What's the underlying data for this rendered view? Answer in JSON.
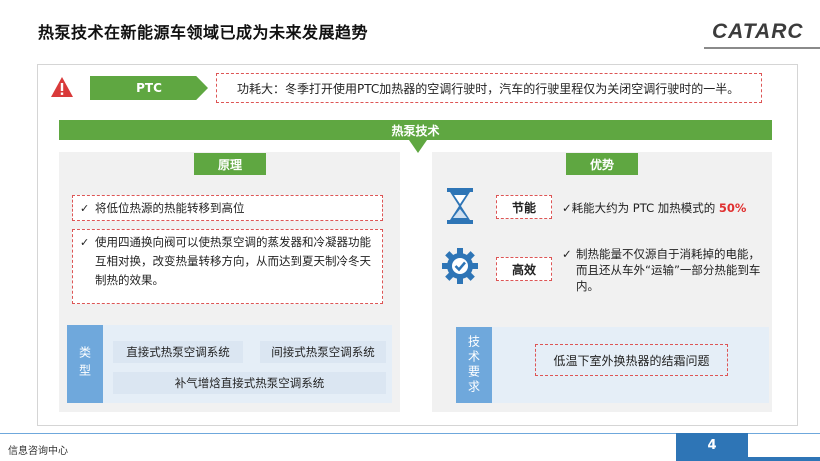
{
  "header": {
    "title": "热泵技术在新能源车领域已成为未来发展趋势",
    "logo": "CATARC"
  },
  "ptc": {
    "label": "PTC",
    "description": "功耗大：冬季打开使用PTC加热器的空调行驶时，汽车的行驶里程仅为关闭空调行驶时的一半。"
  },
  "heat_pump": {
    "label": "热泵技术"
  },
  "principle": {
    "title": "原理",
    "points": [
      "将低位热源的热能转移到高位",
      "使用四通换向阀可以使热泵空调的蒸发器和冷凝器功能互相对换，改变热量转移方向，从而达到夏天制冷冬天制热的效果。"
    ],
    "types_label": "类型",
    "types": [
      "直接式热泵空调系统",
      "间接式热泵空调系统",
      "补气增焓直接式热泵空调系统"
    ]
  },
  "advantages": {
    "title": "优势",
    "items": [
      {
        "tag": "节能",
        "text_prefix": "耗能大约为 PTC 加热模式的 ",
        "highlight": "50%",
        "icon": "hourglass-icon"
      },
      {
        "tag": "高效",
        "text": "制热能量不仅源自于消耗掉的电能，而且还从车外“运输”一部分热能到车内。",
        "icon": "gear-check-icon"
      }
    ],
    "tech_label": "技术要求",
    "tech_issue": "低温下室外换热器的结霜问题"
  },
  "footer": {
    "org": "信息咨询中心",
    "page": "4"
  },
  "colors": {
    "green": "#5fa741",
    "blue": "#2e75b6",
    "light_blue": "#6fa8dc",
    "red_dash": "#dd5555",
    "highlight": "#e03030"
  },
  "tick": "✓"
}
